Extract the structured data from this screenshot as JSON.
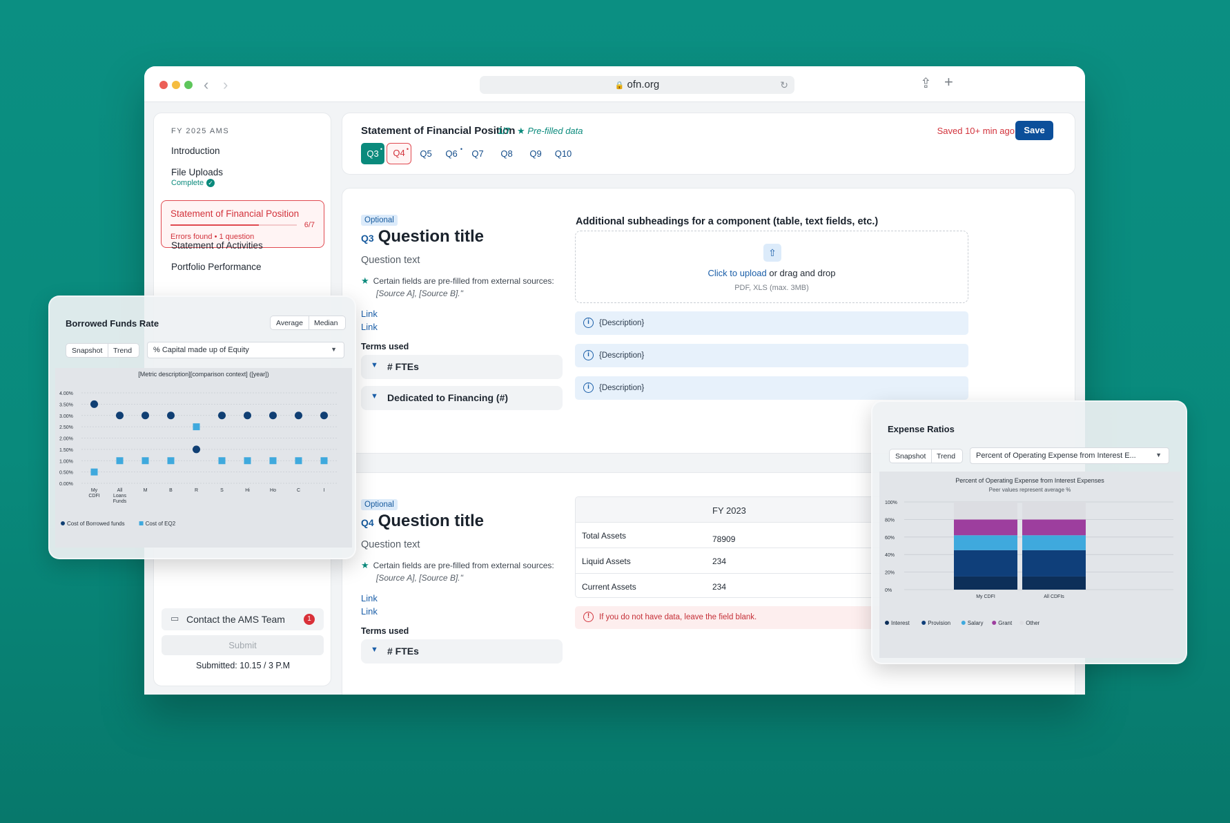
{
  "browser": {
    "url": "ofn.org"
  },
  "sidebar": {
    "heading": "FY 2025 AMS",
    "items": [
      {
        "label": "Introduction"
      },
      {
        "label": "File Uploads",
        "status": "Complete"
      },
      {
        "label": "Statement of Financial Position",
        "progress": "6/7",
        "fill_fraction": 0.7,
        "error": "Errors found",
        "error_detail": "1 question"
      },
      {
        "label": "Statement of Activities"
      },
      {
        "label": "Portfolio Performance"
      }
    ],
    "contact": {
      "label": "Contact the AMS Team",
      "badge": "1"
    },
    "submit_label": "Submit",
    "submitted": "Submitted: 10.15 / 3 P.M"
  },
  "header": {
    "title": "Statement of Financial Position",
    "fraction": "1/7",
    "prefilled": "Pre-filled data",
    "saved": "Saved 10+ min ago",
    "save_label": "Save",
    "tabs": [
      "Q3",
      "Q4",
      "Q5",
      "Q6",
      "Q7",
      "Q8",
      "Q9",
      "Q10"
    ]
  },
  "q3": {
    "badge": "Optional",
    "num": "Q3",
    "title": "Question title",
    "text": "Question text",
    "prefill_note": "Certain fields are pre-filled from external sources:",
    "prefill_sources": "[Source A], [Source B].\"",
    "links": [
      "Link",
      "Link"
    ],
    "terms_label": "Terms used",
    "terms": [
      "# FTEs",
      "Dedicated to Financing (#)"
    ],
    "subheading": "Additional subheadings for a component (table, text fields, etc.)",
    "upload_link": "Click to upload",
    "upload_rest": " or drag and drop",
    "upload_formats": "PDF, XLS (max. 3MB)",
    "descriptions": [
      "{Description}",
      "{Description}",
      "{Description}"
    ]
  },
  "q4": {
    "badge": "Optional",
    "num": "Q4",
    "title": "Question title",
    "text": "Question text",
    "prefill_note": "Certain fields are pre-filled from external sources:",
    "prefill_sources": "[Source A], [Source B].\"",
    "links": [
      "Link",
      "Link"
    ],
    "terms_label": "Terms used",
    "terms": [
      "# FTEs"
    ],
    "table": {
      "header": "FY 2023",
      "rows": [
        {
          "label": "Total Assets",
          "value": "78909"
        },
        {
          "label": "Liquid Assets",
          "value": "234"
        },
        {
          "label": "Current Assets",
          "value": "234"
        }
      ]
    },
    "alert": "If you do not have data, leave the field blank."
  },
  "borrowed": {
    "title": "Borrowed Funds Rate",
    "toggle": [
      "Average",
      "Median"
    ],
    "views": [
      "Snapshot",
      "Trend"
    ],
    "metric": "% Capital made up of Equity",
    "colors": {
      "series1": "#103f73",
      "series2": "#3fa9dd"
    }
  },
  "expense": {
    "title": "Expense Ratios",
    "views": [
      "Snapshot",
      "Trend"
    ],
    "metric": "Percent of Operating Expense from Interest E...",
    "colors": {
      "Interest": "#0d2f59",
      "Provision": "#0f3f7a",
      "Salary": "#3fa9dd",
      "Grant": "#9d3e9e",
      "Other": "#dcdde2"
    }
  },
  "chart_data": [
    {
      "type": "scatter",
      "title": "[Metric description][comparison context] ([year])",
      "categories": [
        "My CDFI",
        "All Loans Funds",
        "M",
        "B",
        "R",
        "S",
        "Hi",
        "Ho",
        "C",
        "I"
      ],
      "category_lines": [
        [
          "My",
          "CDFI"
        ],
        [
          "All",
          "Loans",
          "Funds"
        ],
        [
          "M"
        ],
        [
          "B"
        ],
        [
          "R"
        ],
        [
          "S"
        ],
        [
          "Hi"
        ],
        [
          "Ho"
        ],
        [
          "C"
        ],
        [
          "I"
        ]
      ],
      "y_ticks": [
        "4.00%",
        "3.50%",
        "3.00%",
        "2.50%",
        "2.00%",
        "1.50%",
        "1.00%",
        "0.50%",
        "0.00%"
      ],
      "ylim": [
        0,
        4
      ],
      "series": [
        {
          "name": "Cost of Borrowed funds",
          "marker": "circle",
          "values": [
            3.5,
            3.0,
            3.0,
            3.0,
            1.5,
            3.0,
            3.0,
            3.0,
            3.0,
            3.0
          ]
        },
        {
          "name": "Cost of EQ2",
          "marker": "square",
          "values": [
            0.5,
            1.0,
            1.0,
            1.0,
            2.5,
            1.0,
            1.0,
            1.0,
            1.0,
            1.0
          ]
        }
      ],
      "grid": true,
      "legend": "bottom-left"
    },
    {
      "type": "bar",
      "stacked": true,
      "title": "Percent of Operating Expense from Interest Expenses",
      "subtitle": "Peer values represent average %",
      "categories": [
        "My CDFI",
        "All CDFIs"
      ],
      "y_ticks": [
        "100%",
        "80%",
        "60%",
        "40%",
        "20%",
        "0%"
      ],
      "ylim": [
        0,
        100
      ],
      "series": [
        {
          "name": "Interest",
          "values": [
            15,
            15
          ]
        },
        {
          "name": "Provision",
          "values": [
            30,
            30
          ]
        },
        {
          "name": "Salary",
          "values": [
            17,
            17
          ]
        },
        {
          "name": "Grant",
          "values": [
            18,
            18
          ]
        },
        {
          "name": "Other",
          "values": [
            20,
            20
          ]
        }
      ],
      "grid": true,
      "legend": "bottom-left"
    }
  ]
}
